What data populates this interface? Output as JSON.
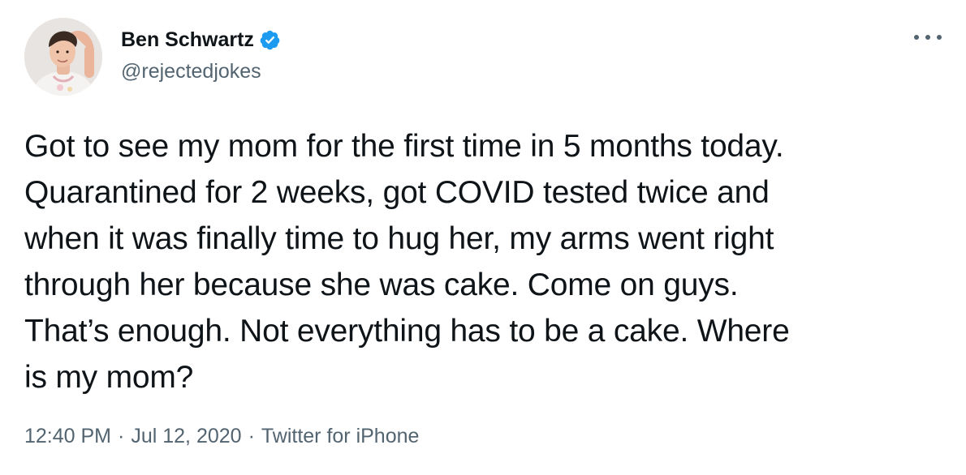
{
  "author": {
    "display_name": "Ben Schwartz",
    "handle": "@rejectedjokes",
    "verified": true,
    "avatar_icon": "profile-photo"
  },
  "tweet": {
    "lines": [
      "Got to see my mom for the first time in 5 months today.",
      "Quarantined for 2 weeks, got COVID tested twice and",
      "when it was finally time to hug her, my arms went right",
      "through her because she was cake. Come on guys.",
      "That’s enough. Not everything has to be a cake. Where",
      "is my mom?"
    ]
  },
  "meta": {
    "time": "12:40 PM",
    "separator": "·",
    "date": "Jul 12, 2020",
    "source": "Twitter for iPhone"
  },
  "icons": {
    "more": "more-options-icon",
    "verified": "verified-badge-icon"
  },
  "colors": {
    "text": "#0f1419",
    "secondary": "#536471",
    "verified_blue": "#1d9bf0"
  }
}
